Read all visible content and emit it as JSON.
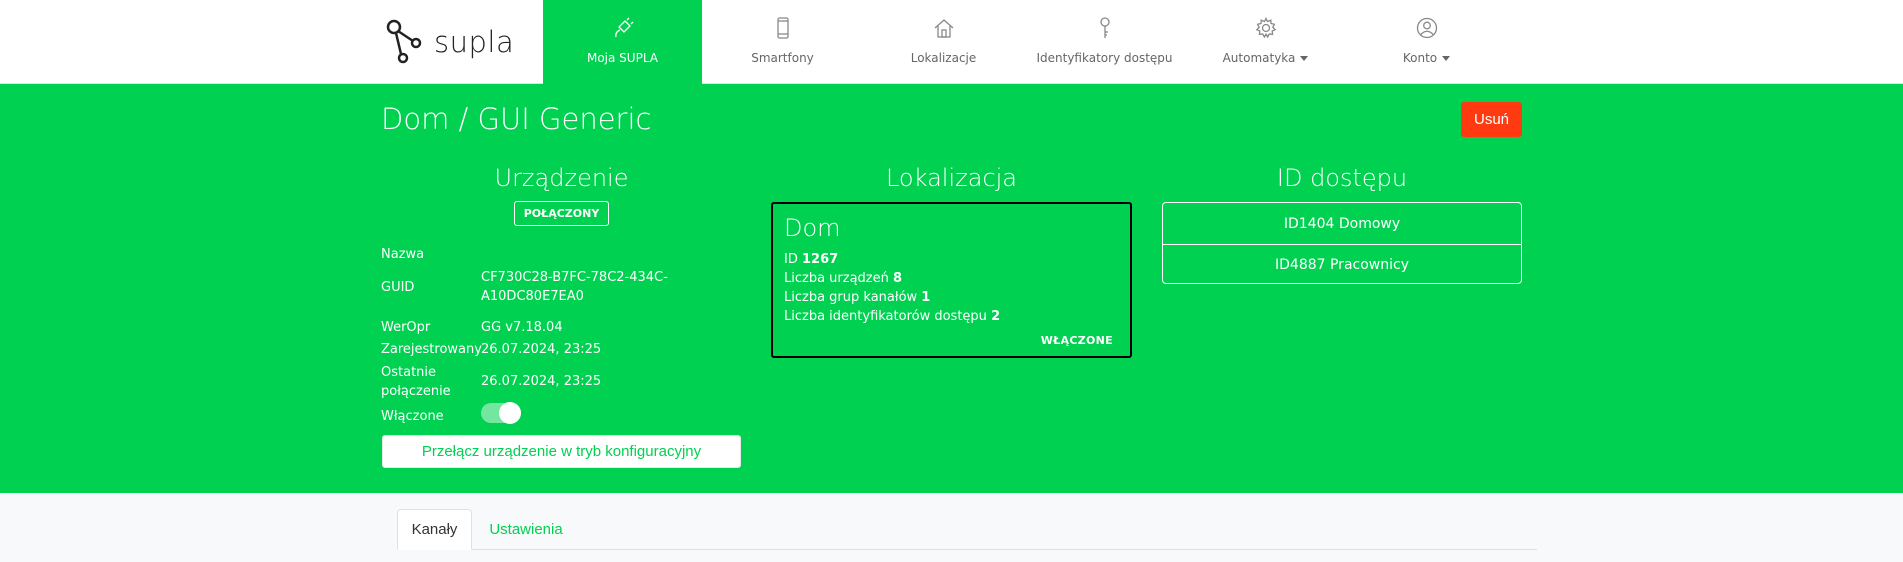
{
  "brand": {
    "name": "supla"
  },
  "nav": [
    {
      "label": "Moja SUPLA",
      "icon": "plug-icon",
      "active": true
    },
    {
      "label": "Smartfony",
      "icon": "smartphone-icon"
    },
    {
      "label": "Lokalizacje",
      "icon": "home-icon"
    },
    {
      "label": "Identyfikatory dostępu",
      "icon": "key-icon"
    },
    {
      "label": "Automatyka",
      "icon": "gear-icon",
      "dropdown": true
    },
    {
      "label": "Konto",
      "icon": "user-icon",
      "dropdown": true
    }
  ],
  "page": {
    "title": "Dom / GUI Generic",
    "delete_label": "Usuń"
  },
  "device": {
    "heading": "Urządzenie",
    "status": "POŁĄCZONY",
    "name_label": "Nazwa",
    "name_value": "",
    "guid_label": "GUID",
    "guid_value_line1": "CF730C28-B7FC-78C2-434C-",
    "guid_value_line2": "A10DC80E7EA0",
    "firmware_label": "WerOpr",
    "firmware_value": "GG v7.18.04",
    "registered_label": "Zarejestrowany",
    "registered_value": "26.07.2024, 23:25",
    "last_connected_label_line1": "Ostatnie",
    "last_connected_label_line2": "połączenie",
    "last_connected_value": "26.07.2024, 23:25",
    "enabled_label": "Włączone",
    "enabled": true,
    "config_button": "Przełącz urządzenie w tryb konfiguracyjny"
  },
  "location": {
    "heading": "Lokalizacja",
    "name": "Dom",
    "id_label": "ID",
    "id_value": "1267",
    "devices_label": "Liczba urządzeń",
    "devices_value": "8",
    "groups_label": "Liczba grup kanałów",
    "groups_value": "1",
    "access_ids_label": "Liczba identyfikatorów dostępu",
    "access_ids_value": "2",
    "state": "WŁĄCZONE"
  },
  "access": {
    "heading": "ID dostępu",
    "items": [
      {
        "label": "ID1404 Domowy"
      },
      {
        "label": "ID4887 Pracownicy"
      }
    ]
  },
  "tabs": [
    {
      "label": "Kanały",
      "active": true
    },
    {
      "label": "Ustawienia"
    }
  ],
  "colors": {
    "accent": "#00d151",
    "danger": "#ff3a10"
  }
}
